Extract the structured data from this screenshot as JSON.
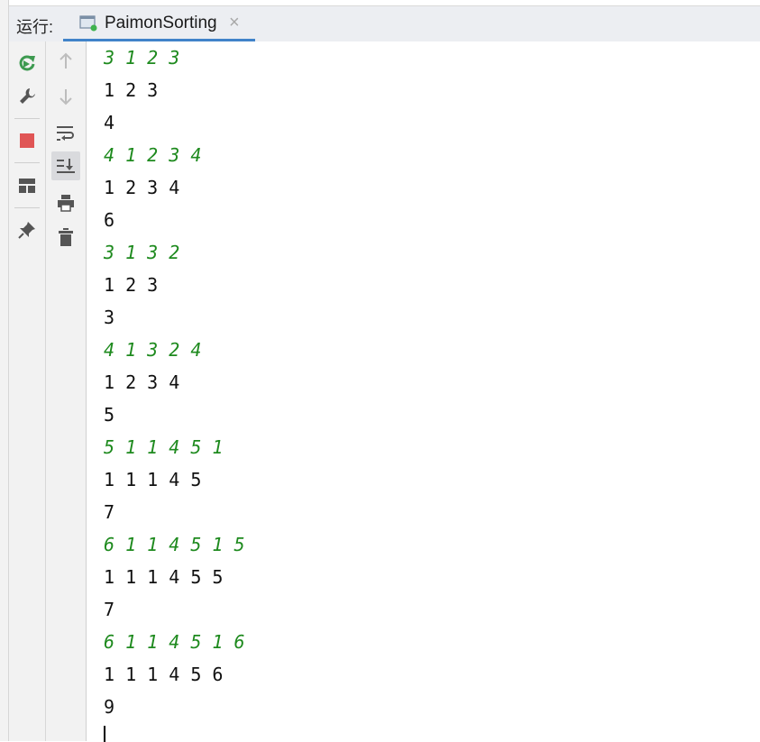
{
  "header": {
    "run_label": "运行:",
    "tab_title": "PaimonSorting",
    "tab_close": "×"
  },
  "toolbar_left": [
    {
      "icon": "rerun-icon",
      "color": "#3d9a50"
    },
    {
      "icon": "wrench-icon",
      "color": "#555555"
    },
    {
      "icon": "stop-icon",
      "color": "#e05555"
    },
    {
      "icon": "layout-icon",
      "color": "#555555"
    },
    {
      "icon": "pin-icon",
      "color": "#555555"
    }
  ],
  "toolbar_right": [
    {
      "icon": "arrow-up-icon",
      "enabled": false
    },
    {
      "icon": "arrow-down-icon",
      "enabled": false
    },
    {
      "icon": "soft-wrap-icon",
      "enabled": true
    },
    {
      "icon": "scroll-to-end-icon",
      "enabled": true,
      "active": true
    },
    {
      "icon": "print-icon",
      "enabled": true
    },
    {
      "icon": "trash-icon",
      "enabled": true
    }
  ],
  "console": {
    "input_color": "#1e8a1e",
    "lines": [
      {
        "text": "3 1 2 3",
        "type": "input"
      },
      {
        "text": "1 2 3",
        "type": "output"
      },
      {
        "text": "4",
        "type": "output"
      },
      {
        "text": "4 1 2 3 4",
        "type": "input"
      },
      {
        "text": "1 2 3 4",
        "type": "output"
      },
      {
        "text": "6",
        "type": "output"
      },
      {
        "text": "3 1 3 2",
        "type": "input"
      },
      {
        "text": "1 2 3",
        "type": "output"
      },
      {
        "text": "3",
        "type": "output"
      },
      {
        "text": "4 1 3 2 4",
        "type": "input"
      },
      {
        "text": "1 2 3 4",
        "type": "output"
      },
      {
        "text": "5",
        "type": "output"
      },
      {
        "text": "5 1 1 4 5 1",
        "type": "input"
      },
      {
        "text": "1 1 1 4 5",
        "type": "output"
      },
      {
        "text": "7",
        "type": "output"
      },
      {
        "text": "6 1 1 4 5 1 5",
        "type": "input"
      },
      {
        "text": "1 1 1 4 5 5",
        "type": "output"
      },
      {
        "text": "7",
        "type": "output"
      },
      {
        "text": "6 1 1 4 5 1 6",
        "type": "input"
      },
      {
        "text": "1 1 1 4 5 6",
        "type": "output"
      },
      {
        "text": "9",
        "type": "output"
      }
    ]
  }
}
